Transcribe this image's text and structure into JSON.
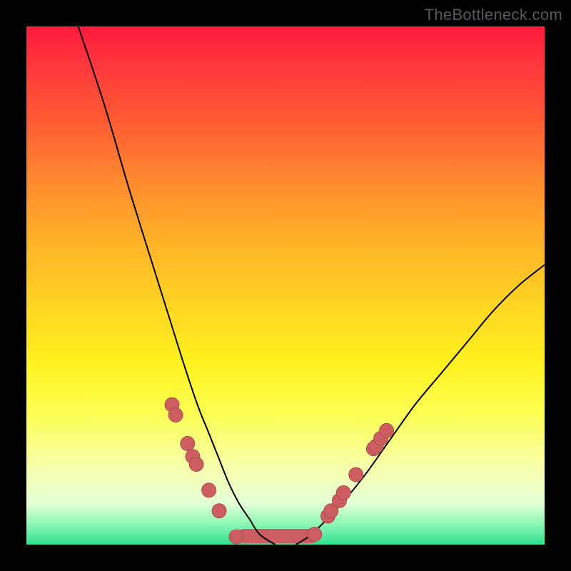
{
  "watermark": "TheBottleneck.com",
  "colors": {
    "curve_stroke": "#000000",
    "floor_stroke": "#2fe08f",
    "dot_fill": "#cc5d61",
    "dot_stroke": "#b14e52",
    "gradient_top": "#ff1a3c",
    "gradient_bottom": "#2fe08f"
  },
  "chart_data": {
    "type": "line",
    "title": "",
    "xlabel": "",
    "ylabel": "",
    "x_range": [
      0,
      100
    ],
    "y_range": [
      0,
      100
    ],
    "axes_visible": false,
    "series": [
      {
        "name": "bottleneck-curve",
        "x": [
          10,
          15,
          20,
          25,
          30,
          33,
          35,
          37,
          39,
          41,
          43,
          45,
          48,
          52,
          55,
          60,
          65,
          70,
          75,
          80,
          85,
          90,
          95,
          100
        ],
        "y_percent": [
          100,
          85,
          68,
          52,
          36,
          27,
          22,
          17,
          12,
          8,
          5,
          2,
          0,
          0,
          2,
          7,
          13,
          20,
          27,
          33,
          39,
          45,
          50,
          54
        ]
      }
    ],
    "floor_segment": {
      "x_start_fraction": 0.42,
      "x_end_fraction": 0.55,
      "y_percent": 0
    },
    "dots_left": [
      {
        "x_fraction": 0.281,
        "percent": 27.0
      },
      {
        "x_fraction": 0.288,
        "percent": 25.0
      },
      {
        "x_fraction": 0.311,
        "percent": 19.5
      },
      {
        "x_fraction": 0.321,
        "percent": 17.0
      },
      {
        "x_fraction": 0.328,
        "percent": 15.5
      },
      {
        "x_fraction": 0.352,
        "percent": 10.5
      },
      {
        "x_fraction": 0.372,
        "percent": 6.5
      },
      {
        "x_fraction": 0.405,
        "percent": 1.5
      }
    ],
    "dots_right": [
      {
        "x_fraction": 0.556,
        "percent": 2.0
      },
      {
        "x_fraction": 0.582,
        "percent": 5.5
      },
      {
        "x_fraction": 0.588,
        "percent": 6.5
      },
      {
        "x_fraction": 0.604,
        "percent": 8.5
      },
      {
        "x_fraction": 0.612,
        "percent": 10.0
      },
      {
        "x_fraction": 0.636,
        "percent": 13.5
      },
      {
        "x_fraction": 0.67,
        "percent": 18.5
      },
      {
        "x_fraction": 0.675,
        "percent": 19.0
      },
      {
        "x_fraction": 0.684,
        "percent": 20.5
      },
      {
        "x_fraction": 0.695,
        "percent": 22.0
      }
    ],
    "dot_radius_px": 10,
    "floor_stroke_px": 20
  }
}
